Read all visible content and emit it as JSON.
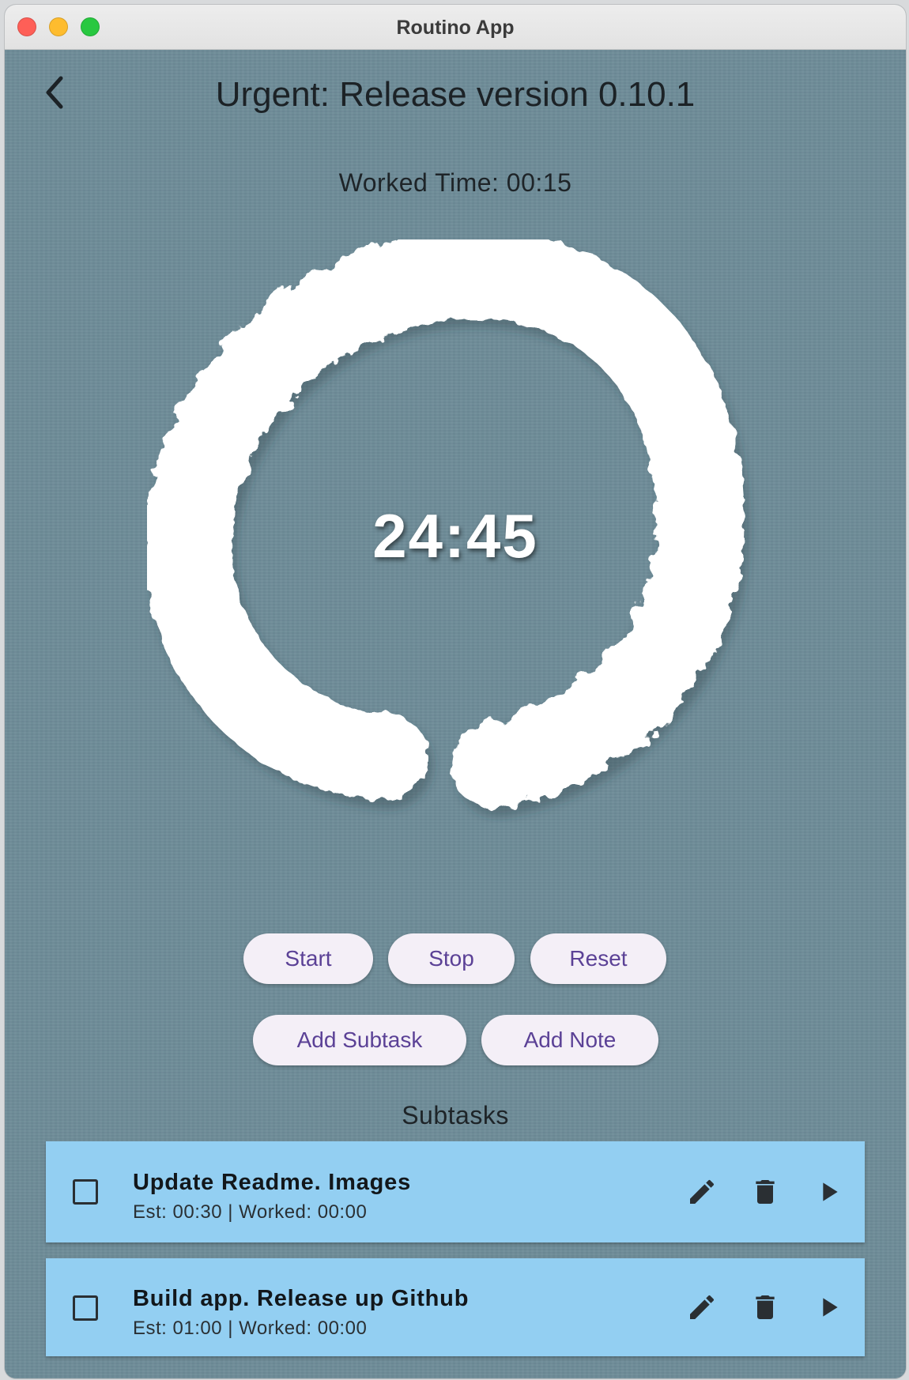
{
  "window": {
    "title": "Routino App"
  },
  "header": {
    "title": "Urgent: Release version 0.10.1"
  },
  "worked_time": "Worked Time: 00:15",
  "timer": "24:45",
  "buttons": {
    "start": "Start",
    "stop": "Stop",
    "reset": "Reset",
    "add_subtask": "Add Subtask",
    "add_note": "Add Note"
  },
  "subtasks": {
    "heading": "Subtasks",
    "items": [
      {
        "title": "Update Readme. Images",
        "meta": "Est: 00:30 | Worked: 00:00"
      },
      {
        "title": "Build app. Release up Github",
        "meta": "Est: 01:00 | Worked: 00:00"
      }
    ]
  },
  "icons": {
    "back": "chevron-left-icon",
    "edit": "pencil-icon",
    "delete": "trash-icon",
    "play": "play-icon"
  },
  "colors": {
    "background": "#6e8c98",
    "button_bg": "#f4eff7",
    "button_text": "#5b4196",
    "subtask_bg": "#93cff2"
  }
}
